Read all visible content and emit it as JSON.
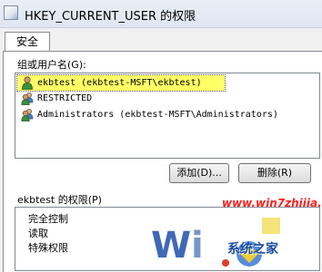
{
  "window": {
    "title": "HKEY_CURRENT_USER 的权限"
  },
  "tabs": [
    {
      "label": "安全"
    }
  ],
  "groups": {
    "label": "组或用户名(G):",
    "items": [
      {
        "name": "ekbtest (ekbtest-MSFT\\ekbtest)",
        "selected": true,
        "icon": "user-icon"
      },
      {
        "name": "RESTRICTED",
        "selected": false,
        "icon": "group-icon"
      },
      {
        "name": "Administrators (ekbtest-MSFT\\Administrators)",
        "selected": false,
        "icon": "group-icon"
      }
    ]
  },
  "buttons": {
    "add": "添加(D)...",
    "remove": "删除(R)"
  },
  "permissions": {
    "label": "ekbtest 的权限(P)",
    "items": [
      "完全控制",
      "读取",
      "特殊权限"
    ]
  },
  "watermark": {
    "url": "www.win7zhijia.cn",
    "site": "系统之家"
  },
  "colors": {
    "selection": "#ffff66",
    "watermark_red": "#ff2020",
    "watermark_blue": "#1a4d9c"
  }
}
